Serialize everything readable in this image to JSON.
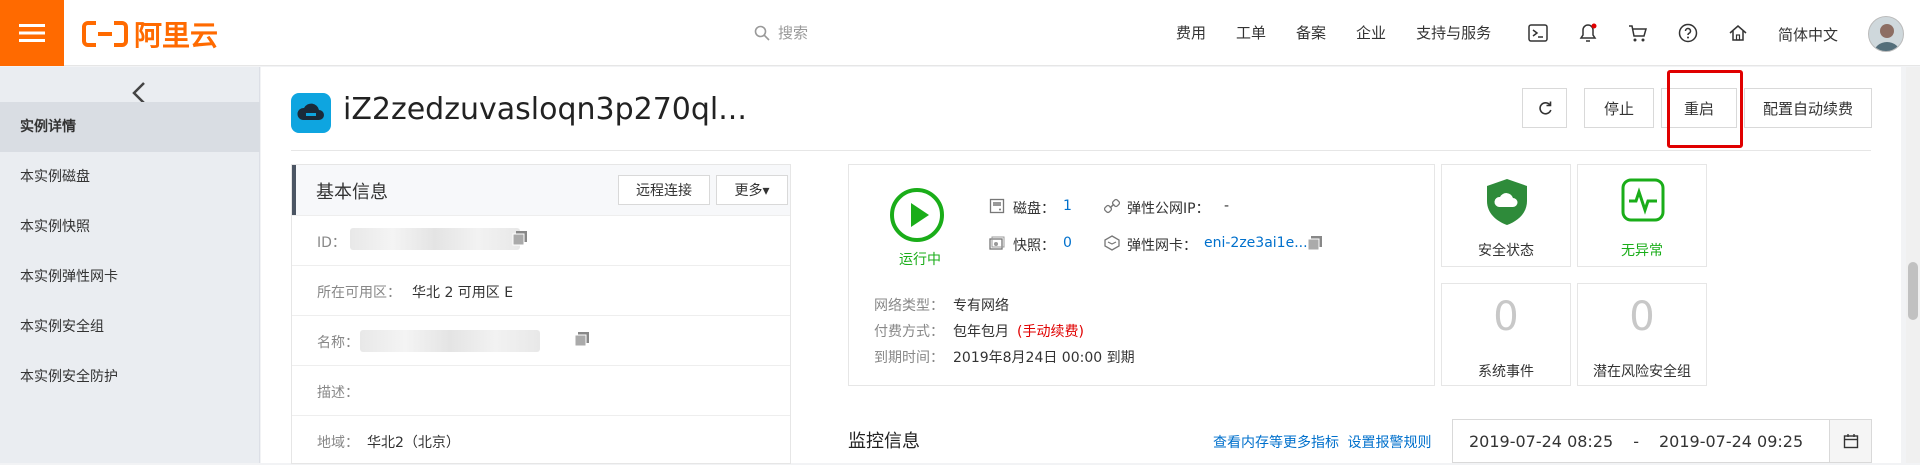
{
  "brand": {
    "logo_text": "阿里云",
    "accent": "#ff6a00"
  },
  "search": {
    "placeholder": "搜索"
  },
  "topnav": {
    "items": [
      "费用",
      "工单",
      "备案",
      "企业",
      "支持与服务"
    ],
    "language": "简体中文"
  },
  "sidebar": {
    "items": [
      "实例详情",
      "本实例磁盘",
      "本实例快照",
      "本实例弹性网卡",
      "本实例安全组",
      "本实例安全防护"
    ],
    "active_index": 0
  },
  "header": {
    "instance_title": "iZ2zedzuvasloqn3p270ql...",
    "buttons": {
      "stop": "停止",
      "restart": "重启",
      "auto_renew": "配置自动续费"
    }
  },
  "basic_info": {
    "title": "基本信息",
    "remote_connect": "远程连接",
    "more": "更多▾",
    "rows": [
      {
        "label": "ID：",
        "value": ""
      },
      {
        "label": "所在可用区：",
        "value": "华北 2 可用区 E"
      },
      {
        "label": "名称：",
        "value": ""
      },
      {
        "label": "描述：",
        "value": ""
      },
      {
        "label": "地域：",
        "value": "华北2（北京）"
      }
    ]
  },
  "status_panel": {
    "state": "运行中",
    "disk_label": "磁盘：",
    "disk_count": "1",
    "snapshot_label": "快照：",
    "snapshot_count": "0",
    "eip_label": "弹性公网IP：",
    "eip_value": "-",
    "eni_label": "弹性网卡：",
    "eni_value": "eni-2ze3ai1e...",
    "network_type_label": "网络类型：",
    "network_type_value": "专有网络",
    "billing_label": "付费方式：",
    "billing_value": "包年包月",
    "billing_note": "(手动续费)",
    "expire_label": "到期时间：",
    "expire_value": "2019年8月24日 00:00 到期"
  },
  "cards": {
    "security_status": "安全状态",
    "no_anomaly": "无异常",
    "system_events_count": "0",
    "system_events": "系统事件",
    "risky_sg_count": "0",
    "risky_sg": "潜在风险安全组"
  },
  "monitoring": {
    "title": "监控信息",
    "link_more": "查看内存等更多指标",
    "link_alarm": "设置报警规则",
    "date_from": "2019-07-24 08:25",
    "date_sep": "-",
    "date_to": "2019-07-24 09:25"
  },
  "colors": {
    "running_green": "#1aad19",
    "link_blue": "#0070cc",
    "warn_red": "#e00000",
    "shield_green": "#2e8b3a"
  }
}
